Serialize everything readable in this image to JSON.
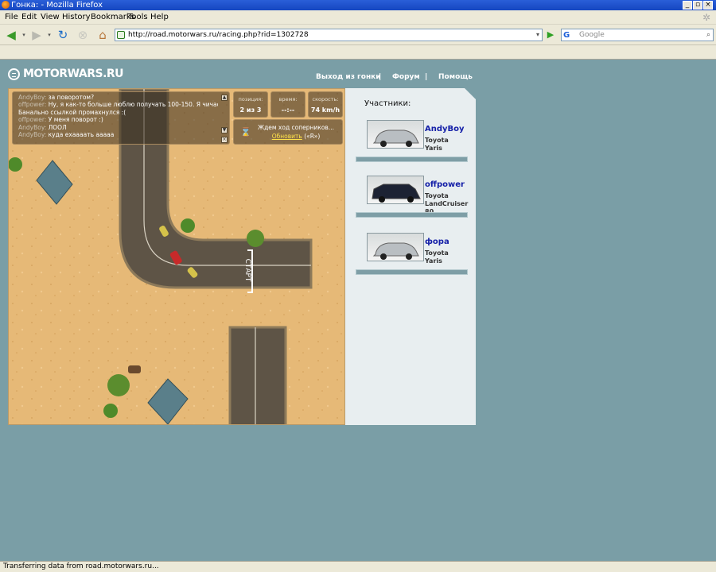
{
  "window": {
    "title": "Гонка: - Mozilla Firefox"
  },
  "menu": [
    "File",
    "Edit",
    "View",
    "History",
    "Bookmarks",
    "Tools",
    "Help"
  ],
  "nav": {
    "url": "http://road.motorwars.ru/racing.php?rid=1302728",
    "search_placeholder": "Google"
  },
  "site": {
    "logo": "MOTORWARS.RU",
    "links": [
      "Выход из гонки",
      "Форум",
      "Помощь"
    ],
    "separator": "|"
  },
  "chat": [
    {
      "user": "AndyBoy:",
      "text": "за поворотом?"
    },
    {
      "user": "offpower:",
      "text": "Ну, я как-то больше люблю получать 100-150. Я чичас"
    },
    {
      "user": "",
      "text": "Банально ссылкой промахнулся :("
    },
    {
      "user": "offpower:",
      "text": "У меня поворот :)"
    },
    {
      "user": "AndyBoy:",
      "text": "ЛООЛ"
    },
    {
      "user": "AndyBoy:",
      "text": "куда ехаааать ааааа"
    }
  ],
  "stats": [
    {
      "label": "позиция:",
      "value": "2 из 3"
    },
    {
      "label": "время:",
      "value": "--:--"
    },
    {
      "label": "скорость:",
      "value": "74 km/h"
    }
  ],
  "wait": {
    "text": "Ждем ход соперников...",
    "update_link": "Обновить",
    "hotkey": "(«R»)"
  },
  "track": {
    "start_label": "СТАРТ"
  },
  "participants": {
    "title": "Участники:",
    "list": [
      {
        "name": "AndyBoy",
        "car": "Toyota Yaris",
        "car_color": "#b9bec2"
      },
      {
        "name": "offpower",
        "car": "Toyota LandCruiser 80",
        "car_color": "#1c2233"
      },
      {
        "name": "фора",
        "car": "Toyota Yaris",
        "car_color": "#b9bec2"
      }
    ]
  },
  "status": "Transferring data from road.motorwars.ru..."
}
